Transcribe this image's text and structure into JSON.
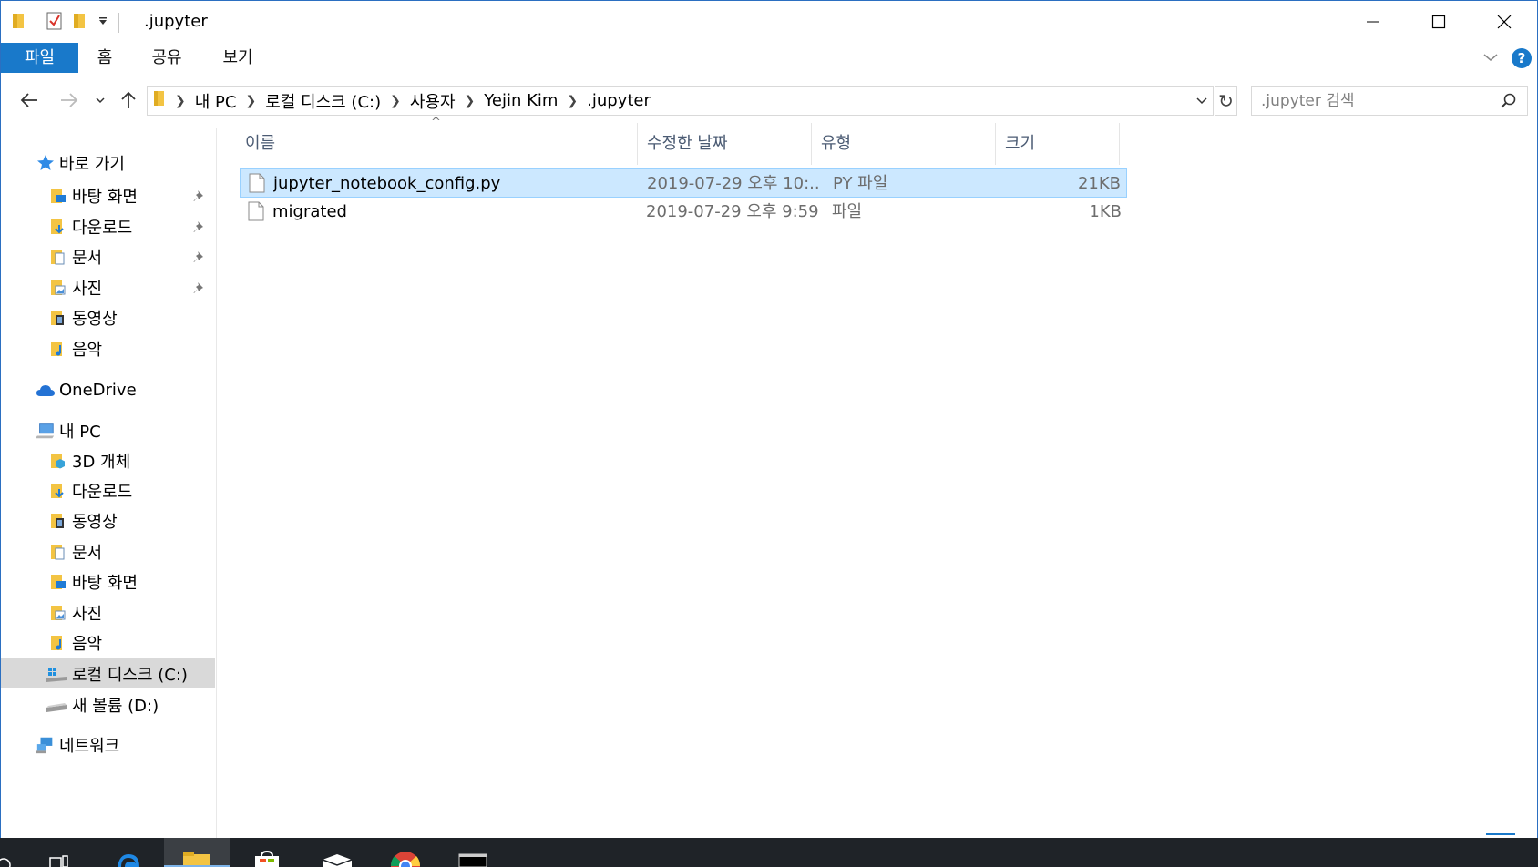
{
  "window": {
    "title": ".jupyter"
  },
  "ribbon": {
    "tabs": [
      "파일",
      "홈",
      "공유",
      "보기"
    ],
    "help": "?"
  },
  "address": {
    "crumbs": [
      "내 PC",
      "로컬 디스크 (C:)",
      "사용자",
      "Yejin Kim",
      ".jupyter"
    ]
  },
  "search": {
    "placeholder": ".jupyter 검색"
  },
  "nav": {
    "quick_access": "바로 가기",
    "quick_items": [
      "바탕 화면",
      "다운로드",
      "문서",
      "사진",
      "동영상",
      "음악"
    ],
    "onedrive": "OneDrive",
    "this_pc": "내 PC",
    "pc_items": [
      "3D 개체",
      "다운로드",
      "동영상",
      "문서",
      "바탕 화면",
      "사진",
      "음악",
      "로컬 디스크 (C:)",
      "새 볼륨 (D:)"
    ],
    "network": "네트워크"
  },
  "columns": {
    "name": "이름",
    "date": "수정한 날짜",
    "type": "유형",
    "size": "크기",
    "sort": "^"
  },
  "files": [
    {
      "name": "jupyter_notebook_config.py",
      "date": "2019-07-29 오후 10:...",
      "type": "PY 파일",
      "size": "21KB"
    },
    {
      "name": "migrated",
      "date": "2019-07-29 오후 9:59",
      "type": "파일",
      "size": "1KB"
    }
  ],
  "colors": {
    "accent": "#1979ca",
    "selection": "#cce8ff",
    "folder": "#f3c443"
  }
}
